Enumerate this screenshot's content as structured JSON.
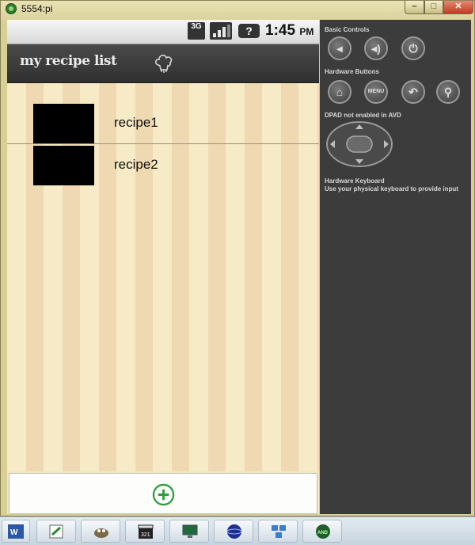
{
  "window": {
    "title": "5554:pi",
    "min_glyph": "–",
    "max_glyph": "□",
    "close_glyph": "✕"
  },
  "statusbar": {
    "network": "3G",
    "battery_glyph": "?",
    "time": "1:45",
    "ampm": "PM"
  },
  "app": {
    "title": "my recipe list",
    "chef_icon": "chef-hat-icon"
  },
  "recipes": [
    {
      "label": "recipe1"
    },
    {
      "label": "recipe2"
    }
  ],
  "footer": {
    "add_icon": "plus-circle-icon",
    "accent": "#2e9e3e"
  },
  "controls": {
    "basic_title": "Basic Controls",
    "hardware_title": "Hardware Buttons",
    "menu_label": "MENU",
    "dpad_title": "DPAD not enabled in AVD",
    "keyboard_title": "Hardware Keyboard",
    "keyboard_note": "Use your physical keyboard to provide input"
  },
  "taskbar": {
    "items": [
      "word-icon",
      "paint-icon",
      "gimp-icon",
      "clapper-icon",
      "monitor-icon",
      "globe-icon",
      "network-icon",
      "android-icon"
    ]
  }
}
